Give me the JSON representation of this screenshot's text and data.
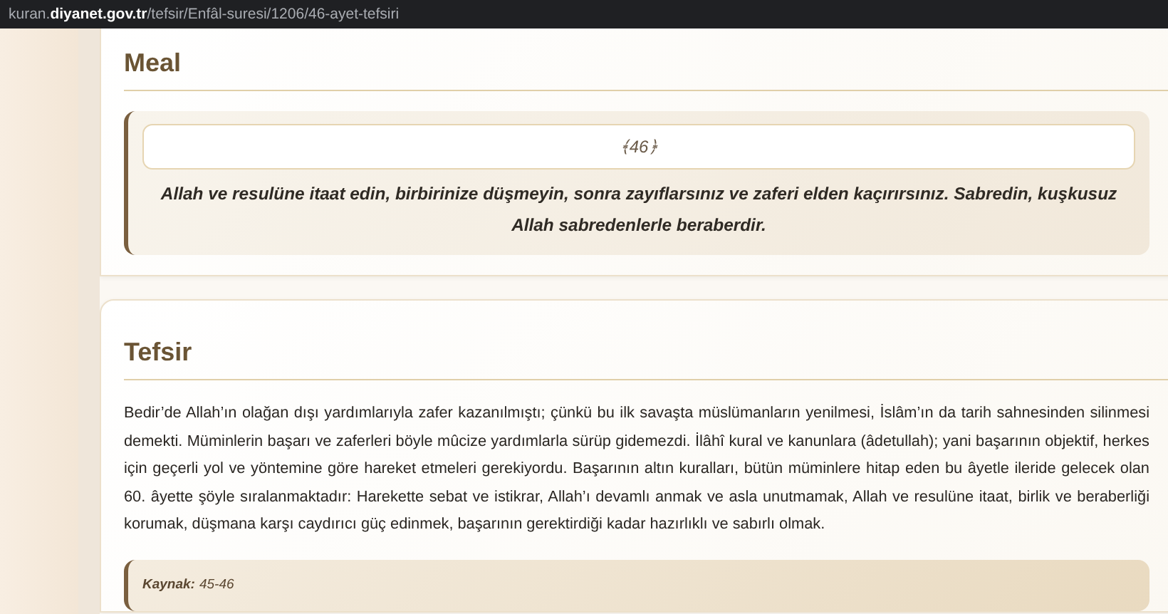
{
  "address_bar": {
    "url": "kuran.**diyanet.gov.tr**/tefsir/Enfâl-suresi/1206/46-ayet-tefsiri"
  },
  "meal": {
    "title": "Meal",
    "verse_number": "﴾46﴿",
    "text": "Allah ve resulüne itaat edin, birbirinize düşmeyin, sonra zayıflarsınız ve zaferi elden kaçırırsınız. Sabredin, kuşkusuz Allah sabredenlerle beraberdir."
  },
  "tefsir": {
    "title": "Tefsir",
    "text": "Bedir’de Allah’ın olağan dışı yardımlarıyla zafer kazanılmıştı; çünkü bu ilk savaşta müslümanların yenilmesi, İslâm’ın da tarih sahnesinden silinmesi demekti. Müminlerin başarı ve zaferleri böyle mûcize yardımlarla sürüp gidemezdi. İlâhî kural ve kanunlara (âdetullah); yani başarının objektif, herkes için geçerli yol ve yöntemine göre hareket etmeleri gerekiyordu. Başarının altın kuralları, bütün müminlere hitap eden bu âyetle ileride gelecek olan 60. âyette şöyle sıralanmaktadır: Harekette sebat ve istikrar, Allah’ı devamlı anmak ve asla unutmamak, Allah ve resulüne itaat, birlik ve beraberliği korumak, düşmana karşı caydırıcı güç edinmek, başarının gerektirdiği kadar hazırlıklı ve sabırlı olmak.",
    "source_label": "Kaynak:",
    "source_value": "45-46"
  }
}
